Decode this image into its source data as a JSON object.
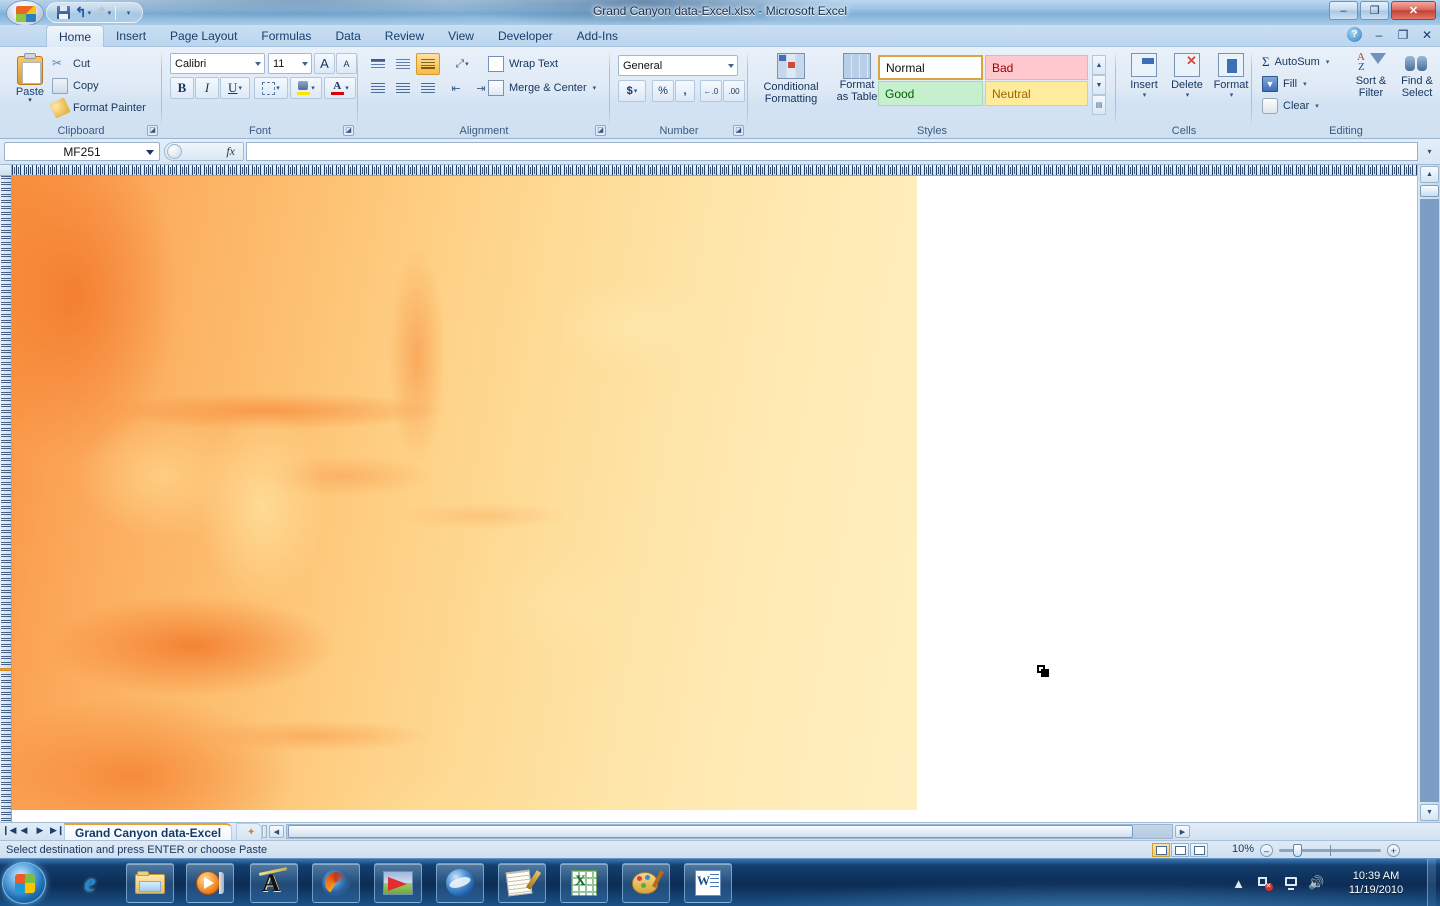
{
  "window": {
    "title": "Grand Canyon data-Excel.xlsx - Microsoft Excel",
    "minimize": "–",
    "restore": "❐",
    "close": "✕"
  },
  "quick_access": {
    "office_button": "office-button",
    "save": "Save",
    "undo": "Undo",
    "redo": "Redo",
    "customize": "Customize Quick Access Toolbar"
  },
  "ribbon": {
    "tabs": [
      {
        "label": "Home",
        "active": true
      },
      {
        "label": "Insert",
        "active": false
      },
      {
        "label": "Page Layout",
        "active": false
      },
      {
        "label": "Formulas",
        "active": false
      },
      {
        "label": "Data",
        "active": false
      },
      {
        "label": "Review",
        "active": false
      },
      {
        "label": "View",
        "active": false
      },
      {
        "label": "Developer",
        "active": false
      },
      {
        "label": "Add-Ins",
        "active": false
      }
    ],
    "help": "?",
    "minimize_ribbon": "–",
    "restore_window": "❐",
    "close_window": "✕",
    "groups": {
      "clipboard": {
        "label": "Clipboard",
        "paste": "Paste",
        "cut": "Cut",
        "copy": "Copy",
        "format_painter": "Format Painter"
      },
      "font": {
        "label": "Font",
        "font_name": "Calibri",
        "font_size": "11",
        "grow_font": "A",
        "shrink_font": "A",
        "bold": "B",
        "italic": "I",
        "underline": "U",
        "borders": "Borders",
        "fill_color": "Fill Color",
        "font_color": "Font Color"
      },
      "alignment": {
        "label": "Alignment",
        "top_align": "Top Align",
        "middle_align": "Middle Align",
        "bottom_align": "Bottom Align",
        "orientation": "Orientation",
        "align_left": "Align Text Left",
        "center": "Center",
        "align_right": "Align Text Right",
        "decrease_indent": "Decrease Indent",
        "increase_indent": "Increase Indent",
        "wrap_text": "Wrap Text",
        "merge_center": "Merge & Center"
      },
      "number": {
        "label": "Number",
        "format": "General",
        "accounting": "$",
        "percent": "%",
        "comma": ",",
        "increase_decimal": "Increase Decimal",
        "decrease_decimal": "Decrease Decimal"
      },
      "styles": {
        "label": "Styles",
        "conditional_formatting": [
          "Conditional",
          "Formatting"
        ],
        "format_as_table": [
          "Format",
          "as Table"
        ],
        "cells": [
          {
            "name": "Normal"
          },
          {
            "name": "Bad"
          },
          {
            "name": "Good"
          },
          {
            "name": "Neutral"
          }
        ]
      },
      "cells": {
        "label": "Cells",
        "insert": "Insert",
        "delete": "Delete",
        "format": "Format"
      },
      "editing": {
        "label": "Editing",
        "autosum": "AutoSum",
        "fill": "Fill",
        "clear": "Clear",
        "sort_filter": [
          "Sort &",
          "Filter"
        ],
        "find_select": [
          "Find &",
          "Select"
        ]
      }
    }
  },
  "formula_bar": {
    "name_box": "MF251",
    "fx_label": "fx",
    "formula_value": "",
    "expand_label": "Expand Formula Bar"
  },
  "sheet": {
    "tabs": [
      {
        "label": "Grand Canyon data-Excel",
        "active": true
      },
      {
        "label": "",
        "active": false
      }
    ],
    "nav_first": "❙◀",
    "nav_prev": "◀",
    "nav_next": "▶",
    "nav_last": "▶❙"
  },
  "status_bar": {
    "message": "Select destination and press ENTER or choose Paste",
    "views": [
      "Normal",
      "Page Layout",
      "Page Break Preview"
    ],
    "zoom": "10%",
    "zoom_out": "–",
    "zoom_in": "+"
  },
  "taskbar": {
    "start": "start-orb",
    "items": [
      {
        "name": "internet-explorer",
        "framed": false
      },
      {
        "name": "windows-explorer",
        "framed": true
      },
      {
        "name": "windows-media-player",
        "framed": true
      },
      {
        "name": "arcmap",
        "framed": true
      },
      {
        "name": "firefox",
        "framed": true
      },
      {
        "name": "google-earth-pointer",
        "framed": true
      },
      {
        "name": "google-earth",
        "framed": true
      },
      {
        "name": "wordpad",
        "framed": true
      },
      {
        "name": "microsoft-excel",
        "framed": true
      },
      {
        "name": "microsoft-paint",
        "framed": true
      },
      {
        "name": "microsoft-word",
        "framed": true
      }
    ],
    "tray": {
      "show_hidden": "▲",
      "network": "network-icon",
      "display": "display-icon",
      "volume": "volume-icon",
      "time": "10:39 AM",
      "date": "11/19/2010"
    }
  },
  "chart_data": {
    "type": "heatmap",
    "title": "Grand Canyon data-Excel",
    "description": "Conditionally-formatted worksheet cells rendered as a color-scale elevation heatmap of Grand Canyon terrain at 10% zoom",
    "color_scale": {
      "low": "#f8903c",
      "mid": "#fdc071",
      "high": "#ffeec0"
    },
    "xlabel": "",
    "ylabel": "",
    "legend": "none",
    "grid": false
  }
}
